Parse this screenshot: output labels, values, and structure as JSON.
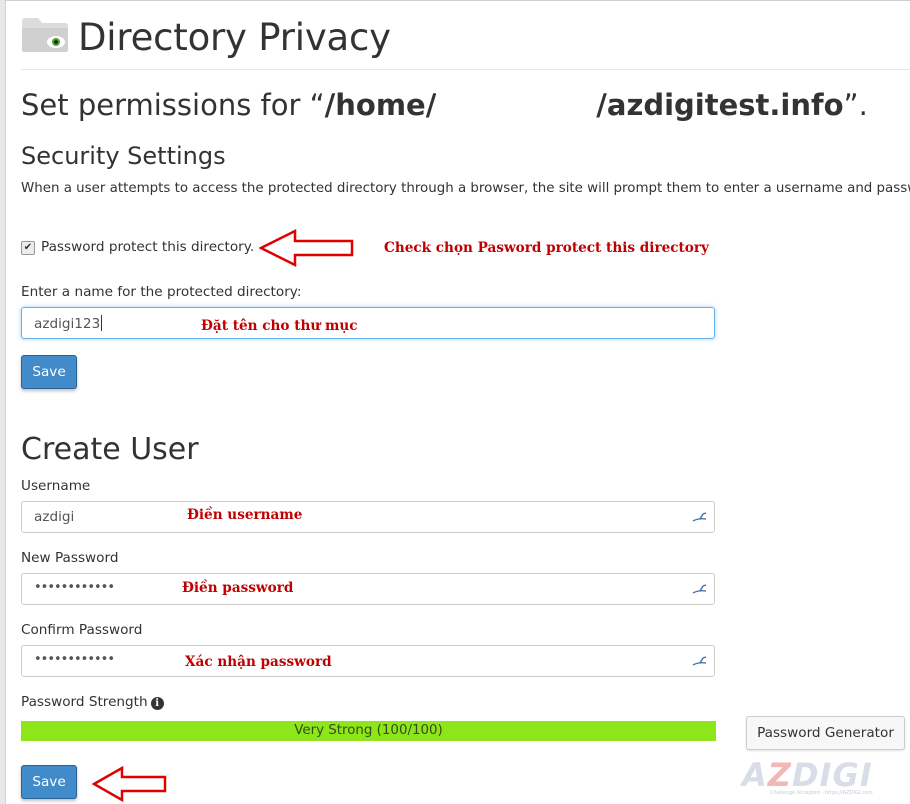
{
  "header": {
    "title": "Directory Privacy",
    "folder_icon": "folder-eye-icon"
  },
  "permissions": {
    "prefix": "Set permissions for “",
    "path_start": "/home/",
    "path_end": "/azdigitest.info",
    "suffix": "”."
  },
  "security": {
    "heading": "Security Settings",
    "description": "When a user attempts to access the protected directory through a browser, the site will prompt them to enter a username and password",
    "checkbox_label": "Password protect this directory.",
    "checkbox_checked": true,
    "name_label": "Enter a name for the protected directory:",
    "name_value": "azdigi123",
    "save_label": "Save"
  },
  "create_user": {
    "heading": "Create User",
    "username_label": "Username",
    "username_value": "azdigi",
    "new_password_label": "New Password",
    "new_password_value": "••••••••••••",
    "confirm_password_label": "Confirm Password",
    "confirm_password_value": "••••••••••••",
    "strength_label": "Password Strength",
    "strength_text": "Very Strong (100/100)",
    "strength_percent": 100,
    "strength_color": "#8ce61a",
    "generator_label": "Password Generator",
    "save_label": "Save"
  },
  "annotations": {
    "checkbox_note": "Check chọn Pasword protect this directory",
    "name_note": "Đặt tên cho thư mục",
    "username_note": "Điền username",
    "password_note": "Điền password",
    "confirm_note": "Xác nhận password",
    "color": "#c00000"
  },
  "logo": {
    "text_a": "A",
    "text_z": "Z",
    "text_digi": "DIGI",
    "tagline": "Challenge Accepted - https://AZDIGI.com"
  }
}
